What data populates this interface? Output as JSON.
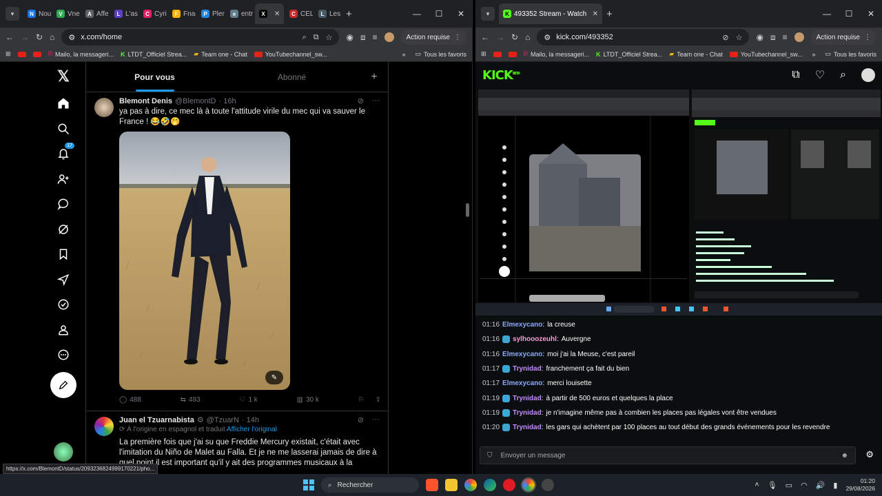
{
  "left_window": {
    "tabs": [
      {
        "label": "Nou",
        "color": "#1a73e8",
        "glyph": "N"
      },
      {
        "label": "Vne",
        "color": "#34a853",
        "glyph": "V"
      },
      {
        "label": "Affe",
        "color": "#5f6368",
        "glyph": "A"
      },
      {
        "label": "L'as",
        "color": "#5a3fc0",
        "glyph": "L"
      },
      {
        "label": "Cyri",
        "color": "#e91e63",
        "glyph": "C"
      },
      {
        "label": "Fnac",
        "color": "#f4b400",
        "glyph": "F"
      },
      {
        "label": "Pler",
        "color": "#1e88e5",
        "glyph": "P"
      },
      {
        "label": "entr",
        "color": "#607d8b",
        "glyph": "e"
      },
      {
        "label": "",
        "color": "#000000",
        "glyph": "X",
        "active": true
      },
      {
        "label": "CEL",
        "color": "#c62828",
        "glyph": "C"
      },
      {
        "label": "Les",
        "color": "#455a64",
        "glyph": "L"
      }
    ],
    "url": "x.com/home",
    "action_label": "Action requise",
    "bookmarks": [
      "Mailo, la messageri...",
      "LTDT_Officiel Strea...",
      "Team one - Chat",
      "YouTubechannel_sw..."
    ],
    "all_favorites": "Tous les favoris",
    "status_url": "https://x.com/BlemontD/status/2093236824999170221/pho..."
  },
  "x": {
    "tabs": {
      "for_you": "Pour vous",
      "following": "Abonné"
    },
    "notif_count": "17",
    "tweet1": {
      "name": "Blemont Denis",
      "handle": "@BlemontD",
      "time": "· 16h",
      "text": "ya pas à dire, ce mec là à toute l'attitude virile du mec qui va sauver le France ! 😂🤣🤭",
      "replies": "488",
      "reposts": "483",
      "likes": "1 k",
      "views": "30 k"
    },
    "tweet2": {
      "name": "Juan el Tzuarnabista",
      "handle": "@TzuarN",
      "time": "· 14h",
      "translated": "À l'origine en espagnol et traduit",
      "show_original": "Afficher l'original",
      "text": "La première fois que j'ai su que Freddie Mercury existait, c'était avec l'imitation du Niño de Malet au Falla. Et je ne me lasserai jamais de dire à quel point il est important qu'il y ait des programmes musicaux à la"
    }
  },
  "right_window": {
    "tab_title": "493352 Stream - Watch Live on",
    "url": "kick.com/493352",
    "action_label": "Action requise",
    "bookmarks": [
      "Mailo, la messageri...",
      "LTDT_Officiel Strea...",
      "Team one - Chat",
      "YouTubechannel_sw..."
    ],
    "all_favorites": "Tous les favoris"
  },
  "kick": {
    "logo": "KICK",
    "logo_sup": "BETA",
    "chat": [
      {
        "time": "01:16",
        "user": "Elmexycano",
        "color": "#8aa7ff",
        "text": "la creuse",
        "badge": false
      },
      {
        "time": "01:16",
        "user": "sylhooozeuhl",
        "color": "#ff9ad5",
        "text": "Auvergne",
        "badge": true
      },
      {
        "time": "01:16",
        "user": "Elmexycano",
        "color": "#8aa7ff",
        "text": "moi j'ai la Meuse, c'est pareil",
        "badge": false
      },
      {
        "time": "01:17",
        "user": "Trynidad",
        "color": "#c58bff",
        "text": "franchement ça fait du bien",
        "badge": true
      },
      {
        "time": "01:17",
        "user": "Elmexycano",
        "color": "#8aa7ff",
        "text": "merci louisette",
        "badge": false
      },
      {
        "time": "01:19",
        "user": "Trynidad",
        "color": "#c58bff",
        "text": "à partir de 500 euros et quelques la place",
        "badge": true
      },
      {
        "time": "01:19",
        "user": "Trynidad",
        "color": "#c58bff",
        "text": "je n'imagine même pas à combien les places pas légales vont être vendues",
        "badge": true
      },
      {
        "time": "01:20",
        "user": "Trynidad",
        "color": "#c58bff",
        "text": "les gars qui achètent par 100 places au tout début des grands événements pour les revendre",
        "badge": true
      }
    ],
    "chat_placeholder": "Envoyer un message"
  },
  "taskbar": {
    "search": "Rechercher",
    "time": "01:20",
    "date": "29/08/2026"
  }
}
